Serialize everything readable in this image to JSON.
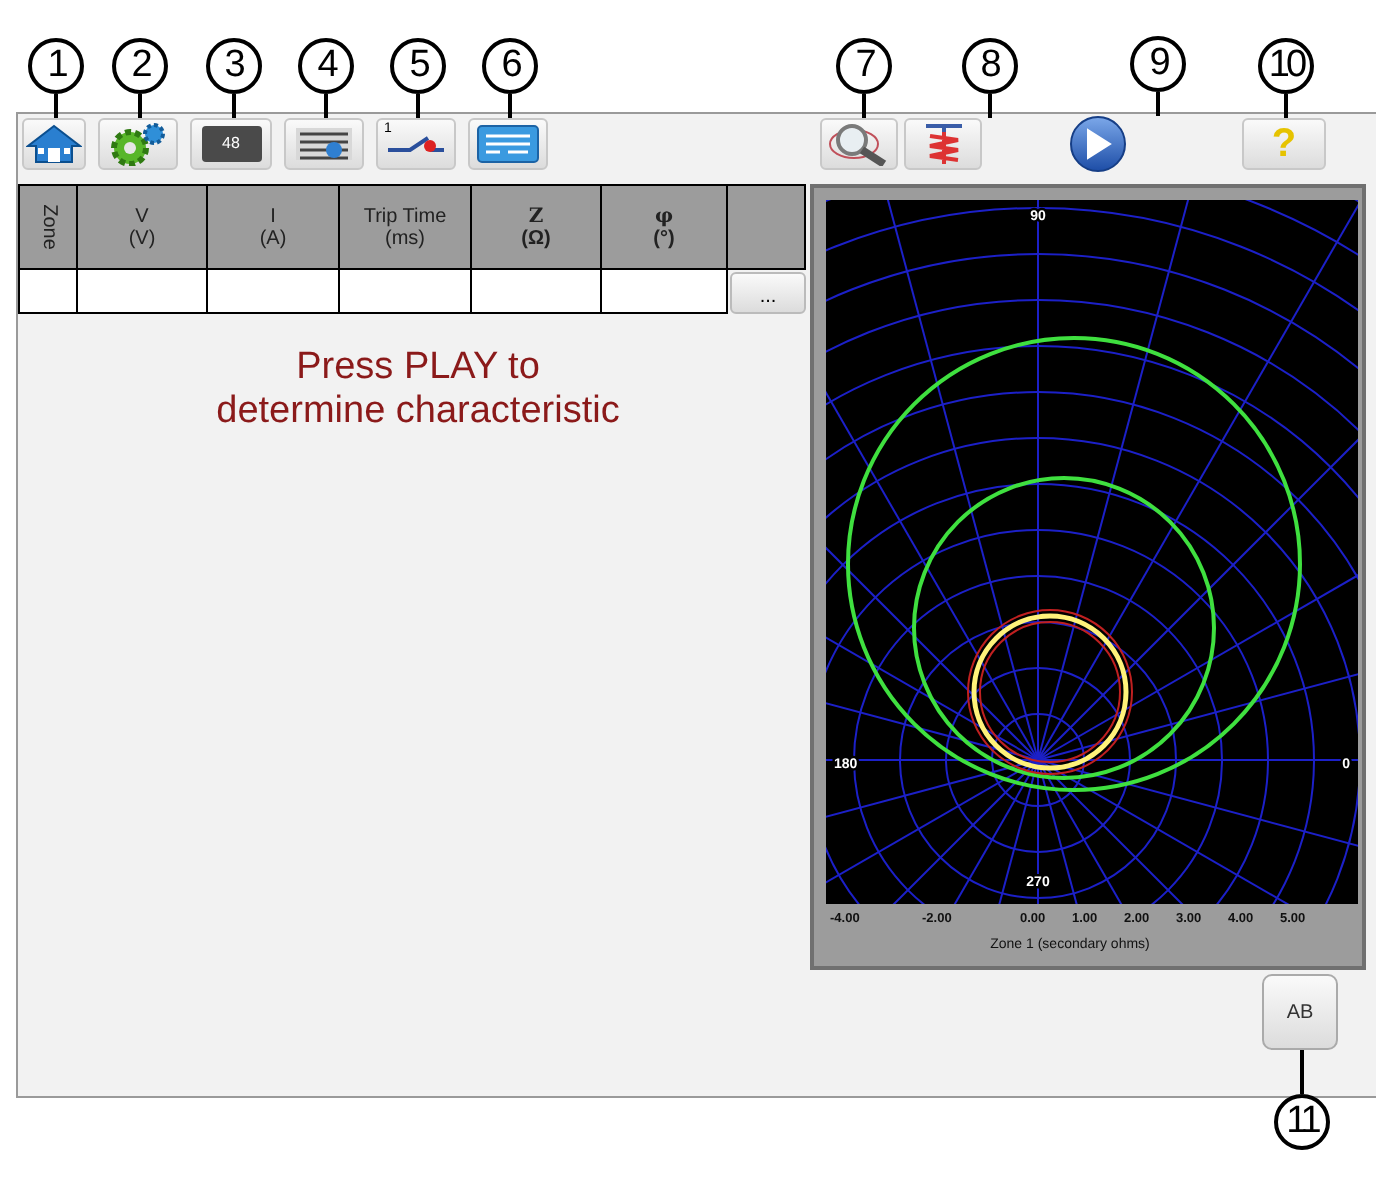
{
  "toolbar_left": [
    {
      "kind": "home",
      "callout": "1"
    },
    {
      "kind": "gear",
      "callout": "2"
    },
    {
      "kind": "battery",
      "callout": "3",
      "text": "48"
    },
    {
      "kind": "settings_panel",
      "callout": "4"
    },
    {
      "kind": "breaker",
      "callout": "5",
      "text": "1"
    },
    {
      "kind": "card",
      "callout": "6"
    }
  ],
  "toolbar_right": [
    {
      "kind": "zoom",
      "callout": "7"
    },
    {
      "kind": "waveform",
      "callout": "8"
    },
    {
      "kind": "play",
      "callout": "9"
    },
    {
      "kind": "help",
      "callout": "10",
      "text": "?"
    }
  ],
  "table": {
    "columns": [
      {
        "kind": "vertical",
        "label": "Zone"
      },
      {
        "label": "V",
        "unit": "(V)"
      },
      {
        "label": "I",
        "unit": "(A)"
      },
      {
        "label": "Trip Time",
        "unit": "(ms)"
      },
      {
        "label": "Z",
        "unit": "(Ω)"
      },
      {
        "label": "φ",
        "unit": "(°)"
      },
      {
        "kind": "blank"
      }
    ],
    "more_button": "..."
  },
  "message": "Press PLAY to\ndetermine characteristic",
  "plot": {
    "angle_labels": [
      "90",
      "180",
      "0",
      "270"
    ],
    "x_tick_labels": [
      "-4.00",
      "-2.00",
      "0.00",
      "1.00",
      "2.00",
      "3.00",
      "4.00",
      "5.00"
    ],
    "x_axis_title": "Zone 1 (secondary ohms)"
  },
  "ab_button": {
    "label": "AB",
    "callout": "11"
  }
}
